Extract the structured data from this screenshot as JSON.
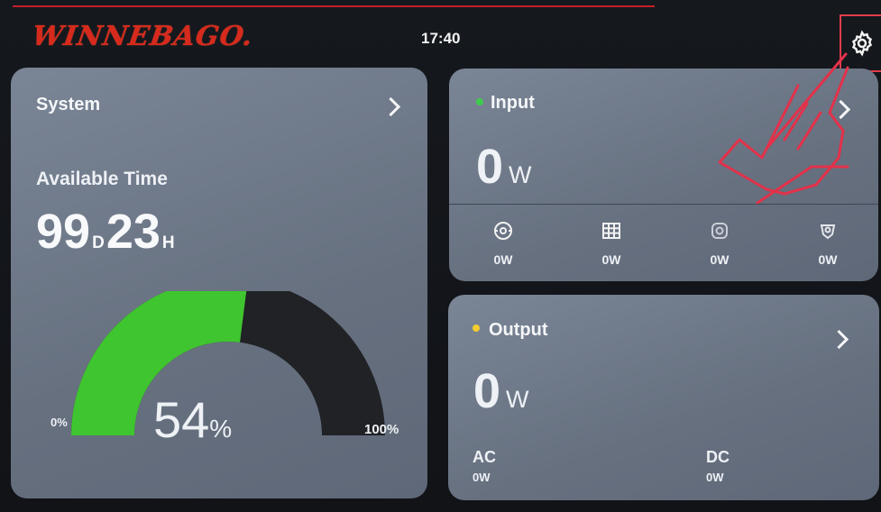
{
  "header": {
    "brand": "WINNEBAGO.",
    "time": "17:40",
    "settings_icon": "gear-icon"
  },
  "system": {
    "title": "System",
    "available_time_label": "Available Time",
    "days": "99",
    "days_unit": "D",
    "hours": "23",
    "hours_unit": "H",
    "battery_percent": 54,
    "battery_percent_text": "54",
    "percent_symbol": "%",
    "gauge_min": "0%",
    "gauge_max": "100%",
    "gauge_fill_color": "#3fc52f"
  },
  "input": {
    "title": "Input",
    "status_color": "#3dcc4f",
    "power_value": "0",
    "power_unit": "W",
    "sources": [
      {
        "icon": "generator-icon",
        "value": "0W"
      },
      {
        "icon": "solar-panel-icon",
        "value": "0W"
      },
      {
        "icon": "car-charger-icon",
        "value": "0W"
      },
      {
        "icon": "shore-power-icon",
        "value": "0W"
      }
    ]
  },
  "output": {
    "title": "Output",
    "status_color": "#f4cc2e",
    "power_value": "0",
    "power_unit": "W",
    "ac_label": "AC",
    "ac_value": "0W",
    "dc_label": "DC",
    "dc_value": "0W"
  }
}
